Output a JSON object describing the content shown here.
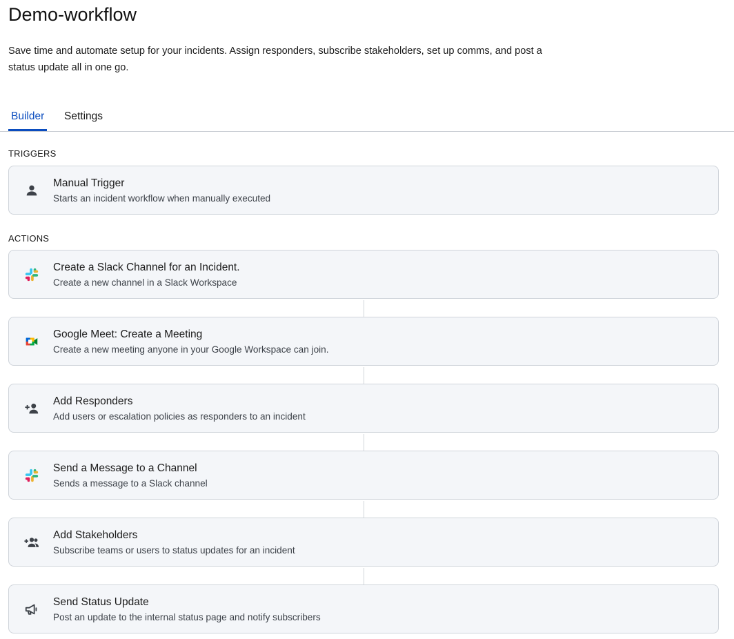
{
  "page": {
    "title": "Demo-workflow",
    "description": "Save time and automate setup for your incidents. Assign responders, subscribe stakeholders, set up comms, and post a status update all in one go."
  },
  "tabs": [
    {
      "label": "Builder",
      "active": true
    },
    {
      "label": "Settings",
      "active": false
    }
  ],
  "colors": {
    "accent": "#0b4dbf",
    "card_background": "#f4f6f9",
    "card_border": "#cfd4da",
    "icon": "#3d4249"
  },
  "triggers": {
    "label": "TRIGGERS",
    "items": [
      {
        "icon": "person-icon",
        "title": "Manual Trigger",
        "subtitle": "Starts an incident workflow when manually executed"
      }
    ]
  },
  "actions": {
    "label": "ACTIONS",
    "items": [
      {
        "icon": "slack-icon",
        "title": "Create a Slack Channel for an Incident.",
        "subtitle": "Create a new channel in a Slack Workspace"
      },
      {
        "icon": "google-meet-icon",
        "title": "Google Meet: Create a Meeting",
        "subtitle": "Create a new meeting anyone in your Google Workspace can join."
      },
      {
        "icon": "add-person-icon",
        "title": "Add Responders",
        "subtitle": "Add users or escalation policies as responders to an incident"
      },
      {
        "icon": "slack-icon",
        "title": "Send a Message to a Channel",
        "subtitle": "Sends a message to a Slack channel"
      },
      {
        "icon": "add-group-icon",
        "title": "Add Stakeholders",
        "subtitle": "Subscribe teams or users to status updates for an incident"
      },
      {
        "icon": "megaphone-icon",
        "title": "Send Status Update",
        "subtitle": "Post an update to the internal status page and notify subscribers"
      }
    ]
  }
}
